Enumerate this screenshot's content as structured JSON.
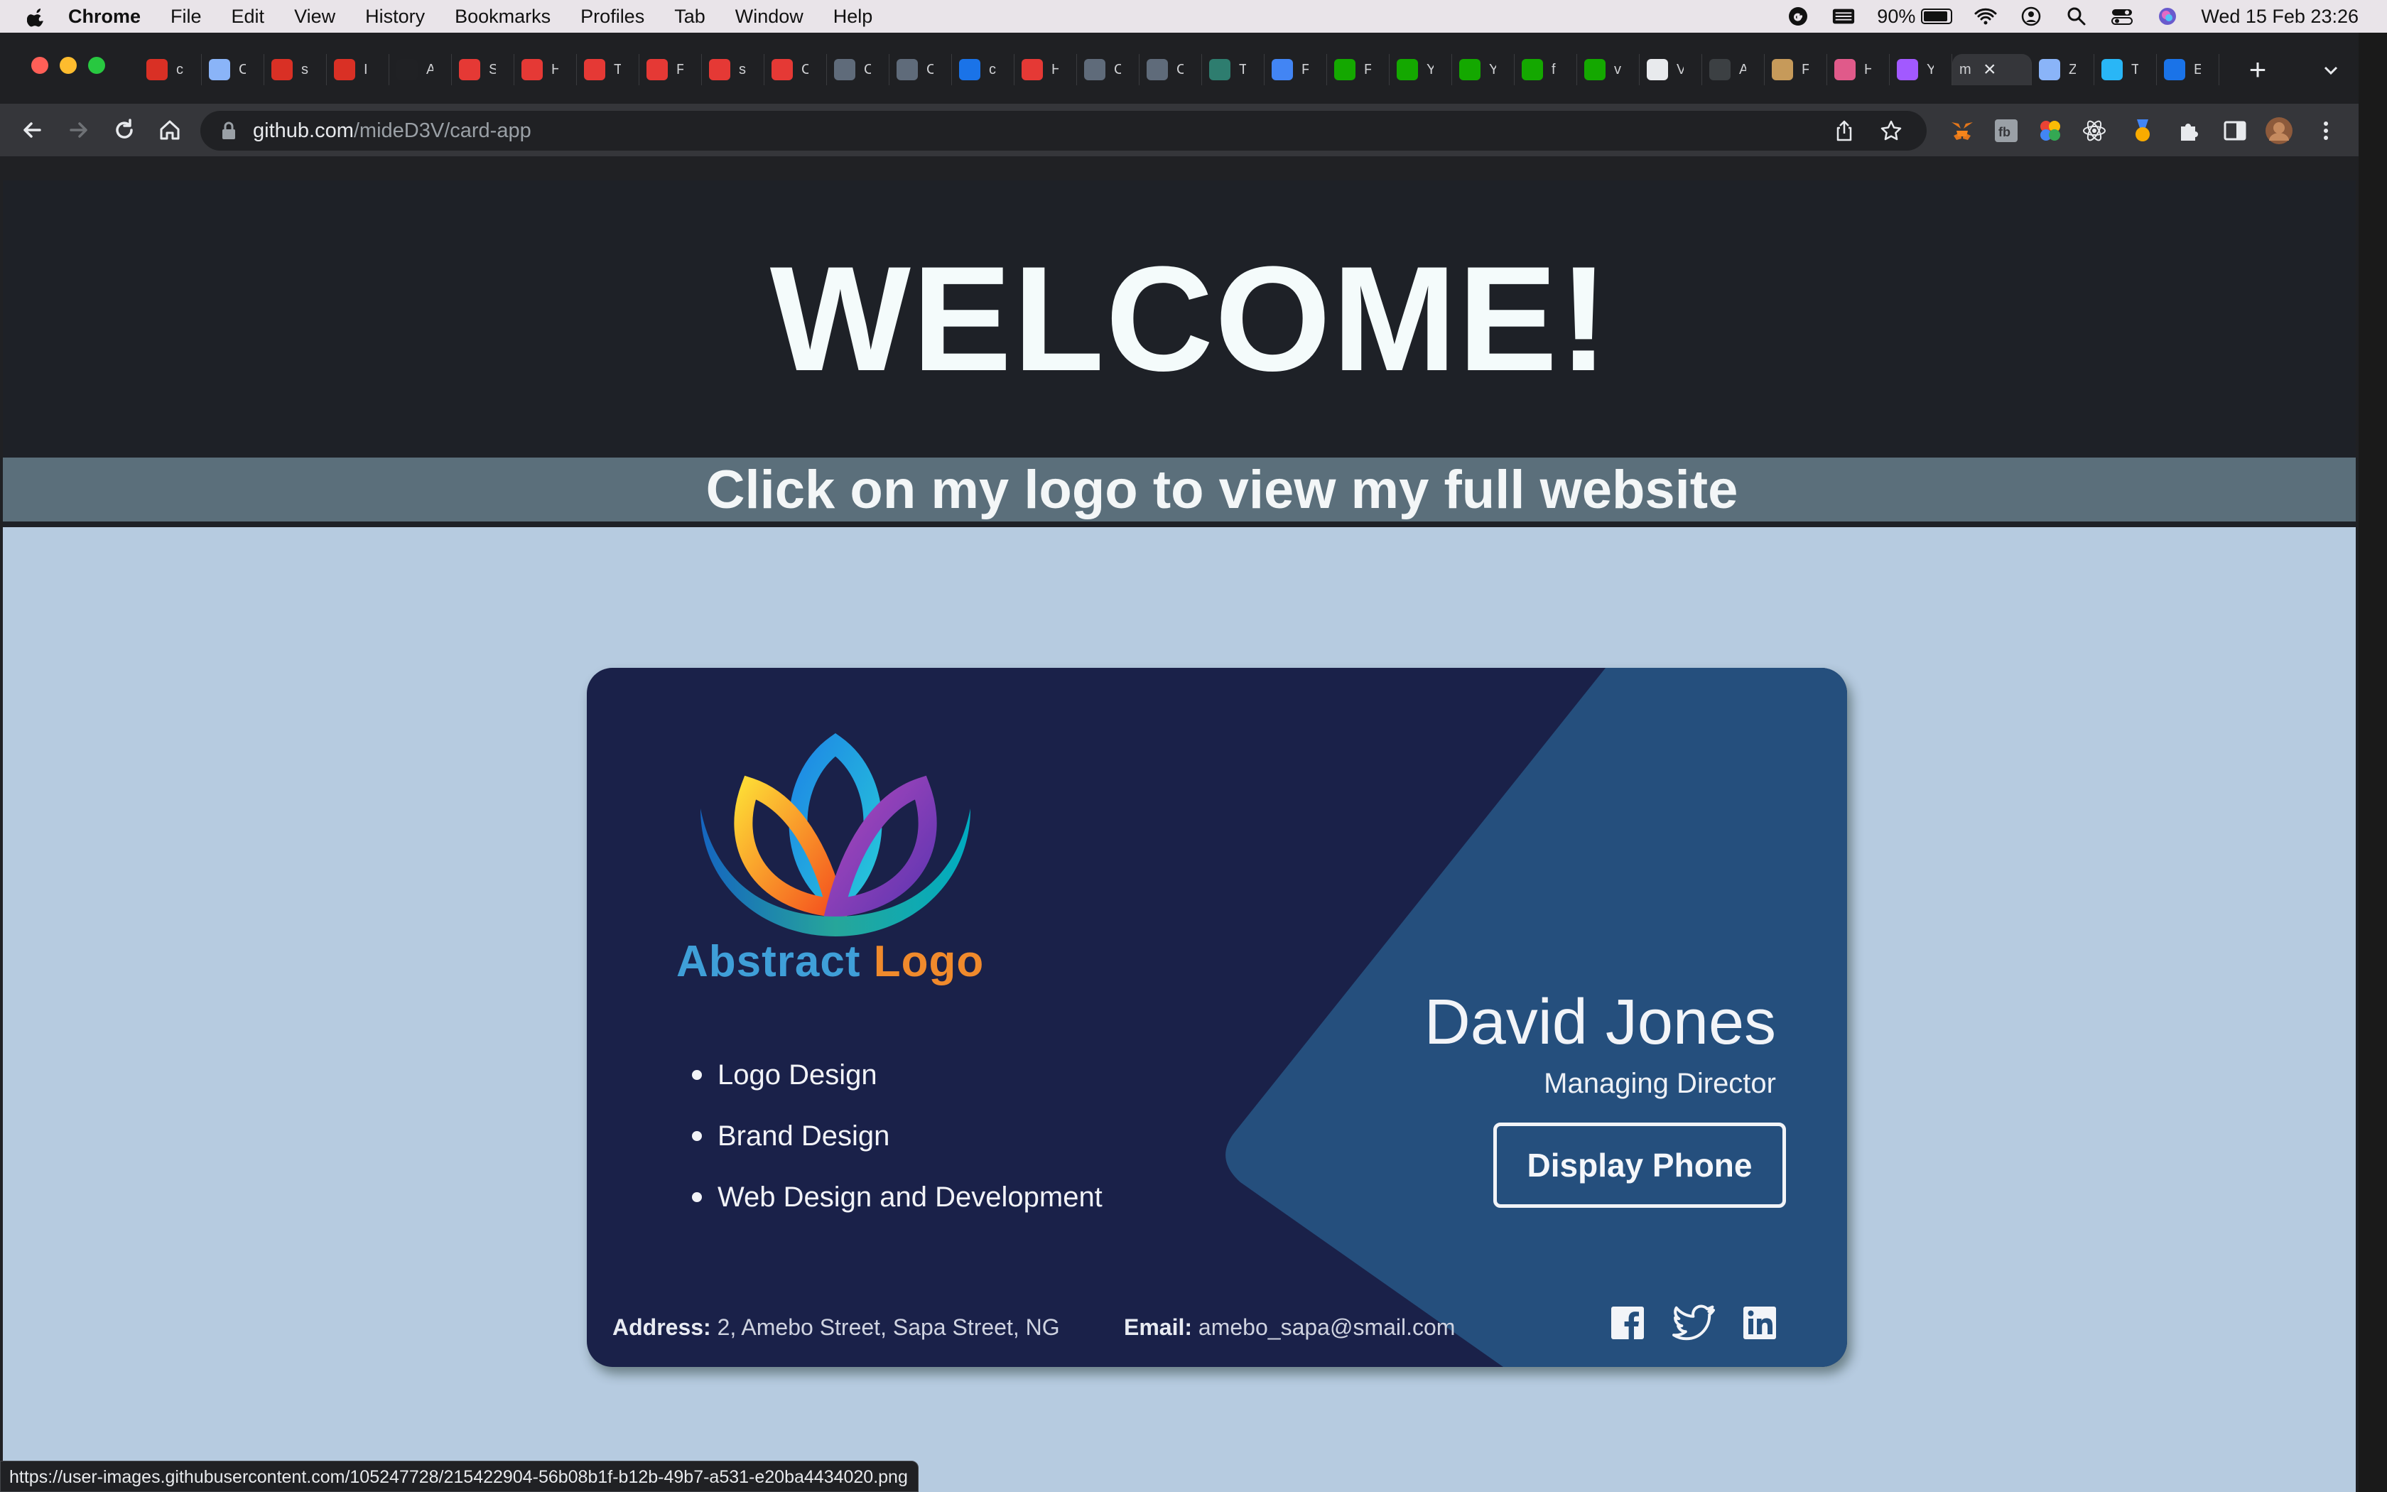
{
  "menubar": {
    "app": "Chrome",
    "items": [
      "File",
      "Edit",
      "View",
      "History",
      "Bookmarks",
      "Profiles",
      "Tab",
      "Window",
      "Help"
    ],
    "battery": "90%",
    "battery_level": 0.9,
    "datetime": "Wed 15 Feb  23:26"
  },
  "browser": {
    "tabs": [
      {
        "icon": "maple-leaf-icon",
        "letter": "c",
        "color": "#d93025"
      },
      {
        "icon": "globe-icon",
        "letter": "C",
        "color": "#8ab4f8"
      },
      {
        "icon": "maple-leaf-icon",
        "letter": "s",
        "color": "#d93025"
      },
      {
        "icon": "maple-leaf-icon",
        "letter": "I",
        "color": "#d93025"
      },
      {
        "icon": "seven-icon",
        "letter": "A",
        "color": "#202124"
      },
      {
        "icon": "s-icon",
        "letter": "S",
        "color": "#e53935"
      },
      {
        "icon": "s-icon",
        "letter": "H",
        "color": "#e53935"
      },
      {
        "icon": "s-icon",
        "letter": "T",
        "color": "#e53935"
      },
      {
        "icon": "s-icon",
        "letter": "F",
        "color": "#e53935"
      },
      {
        "icon": "s-icon",
        "letter": "s",
        "color": "#e53935"
      },
      {
        "icon": "s-icon",
        "letter": "C",
        "color": "#e53935"
      },
      {
        "icon": "stack-icon",
        "letter": "C",
        "color": "#5f6b7a"
      },
      {
        "icon": "stack-icon",
        "letter": "C",
        "color": "#5f6b7a"
      },
      {
        "icon": "search-icon",
        "letter": "c",
        "color": "#1a73e8"
      },
      {
        "icon": "a-icon",
        "letter": "H",
        "color": "#e53935"
      },
      {
        "icon": "stack-icon",
        "letter": "C",
        "color": "#5f6b7a"
      },
      {
        "icon": "stack-icon",
        "letter": "C",
        "color": "#5f6b7a"
      },
      {
        "icon": "cube-icon",
        "letter": "T",
        "color": "#2e7d6f"
      },
      {
        "icon": "grid-icon",
        "letter": "F",
        "color": "#4285f4"
      },
      {
        "icon": "upwork-icon",
        "letter": "F",
        "color": "#14a800"
      },
      {
        "icon": "upwork-icon",
        "letter": "Y",
        "color": "#14a800"
      },
      {
        "icon": "upwork-icon",
        "letter": "Y",
        "color": "#14a800"
      },
      {
        "icon": "upwork-icon",
        "letter": "f",
        "color": "#14a800"
      },
      {
        "icon": "upwork-icon",
        "letter": "v",
        "color": "#14a800"
      },
      {
        "icon": "trello-icon",
        "letter": "V",
        "color": "#e8eaed"
      },
      {
        "icon": "a-circle-icon",
        "letter": "A",
        "color": "#3c4043"
      },
      {
        "icon": "pin-icon",
        "letter": "F",
        "color": "#c69a5a"
      },
      {
        "icon": "square-icon",
        "letter": "H",
        "color": "#e05a8a"
      },
      {
        "icon": "figma-icon",
        "letter": "Y",
        "color": "#a259ff"
      }
    ],
    "active_tab": {
      "letter": "m",
      "close": "×"
    },
    "after_tabs": [
      {
        "icon": "globe-icon",
        "letter": "Z",
        "color": "#8ab4f8"
      },
      {
        "icon": "diamond-icon",
        "letter": "T",
        "color": "#29b6f6"
      },
      {
        "icon": "search-icon",
        "letter": "E",
        "color": "#1a73e8"
      }
    ],
    "url_host": "github.com",
    "url_path": "/mideD3V/card-app",
    "status_url": "https://user-images.githubusercontent.com/105247728/215422904-56b08b1f-b12b-49b7-a531-e20ba4434020.png"
  },
  "page": {
    "hero_title": "WELCOME!",
    "banner": "Click on my logo to view my full website",
    "card": {
      "logo_text_a": "Abstract",
      "logo_text_b": " Logo",
      "services": [
        "Logo Design",
        "Brand Design",
        "Web Design and Development"
      ],
      "name": "David Jones",
      "role": "Managing Director",
      "phone_button": "Display Phone",
      "address_label": "Address:",
      "address": " 2, Amebo Street, Sapa Street, NG",
      "email_label": "Email:",
      "email": " amebo_sapa@smail.com",
      "social": [
        "facebook-icon",
        "twitter-icon",
        "linkedin-icon"
      ],
      "colors": {
        "card_bg": "#1a2149",
        "accent_panel": "#254f7d",
        "page_bg": "#b6cbe0"
      }
    }
  }
}
